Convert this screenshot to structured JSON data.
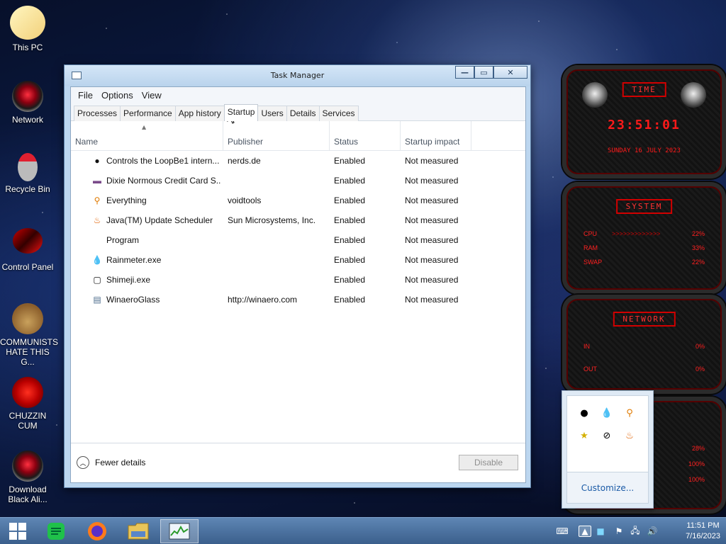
{
  "desktop": {
    "icons": [
      {
        "label": "This PC"
      },
      {
        "label": "Network"
      },
      {
        "label": "Recycle Bin"
      },
      {
        "label": "Control Panel"
      },
      {
        "label": "COMMUNISTS HATE THIS G..."
      },
      {
        "label": "CHUZZIN CUM"
      },
      {
        "label": "Download Black Ali..."
      }
    ]
  },
  "rainmeter": {
    "time": {
      "header": "TIME",
      "clock": "23:51:01",
      "date": "SUNDAY 16 JULY 2023"
    },
    "system": {
      "header": "SYSTEM",
      "rows": [
        {
          "label": "CPU",
          "value": "22%"
        },
        {
          "label": "RAM",
          "value": "33%"
        },
        {
          "label": "SWAP",
          "value": "22%"
        }
      ]
    },
    "network": {
      "header": "NETWORK",
      "rows": [
        {
          "label": "IN",
          "value": "0%"
        },
        {
          "label": "OUT",
          "value": "0%"
        }
      ]
    },
    "disk": {
      "rows": [
        {
          "value": "28%"
        },
        {
          "value": "100%"
        },
        {
          "value": "100%"
        }
      ]
    }
  },
  "tray_popup": {
    "customize": "Customize..."
  },
  "task_manager": {
    "title": "Task Manager",
    "menu": [
      "File",
      "Options",
      "View"
    ],
    "tabs": [
      "Processes",
      "Performance",
      "App history",
      "Startup",
      "Users",
      "Details",
      "Services"
    ],
    "active_tab": "Startup",
    "columns": [
      "Name",
      "Publisher",
      "Status",
      "Startup impact"
    ],
    "rows": [
      {
        "icon": "loopbe-icon",
        "name": "Controls the LoopBe1 intern...",
        "publisher": "nerds.de",
        "status": "Enabled",
        "impact": "Not measured"
      },
      {
        "icon": "card-icon",
        "name": "Dixie Normous Credit Card S...",
        "publisher": "",
        "status": "Enabled",
        "impact": "Not measured"
      },
      {
        "icon": "magnifier-icon",
        "name": "Everything",
        "publisher": "voidtools",
        "status": "Enabled",
        "impact": "Not measured"
      },
      {
        "icon": "java-icon",
        "name": "Java(TM) Update Scheduler",
        "publisher": "Sun Microsystems, Inc.",
        "status": "Enabled",
        "impact": "Not measured"
      },
      {
        "icon": "blank-icon",
        "name": "Program",
        "publisher": "",
        "status": "Enabled",
        "impact": "Not measured"
      },
      {
        "icon": "drop-icon",
        "name": "Rainmeter.exe",
        "publisher": "",
        "status": "Enabled",
        "impact": "Not measured"
      },
      {
        "icon": "shimeji-icon",
        "name": "Shimeji.exe",
        "publisher": "",
        "status": "Enabled",
        "impact": "Not measured"
      },
      {
        "icon": "window-icon",
        "name": "WinaeroGlass",
        "publisher": "http://winaero.com",
        "status": "Enabled",
        "impact": "Not measured"
      }
    ],
    "fewer_details": "Fewer details",
    "disable_button": "Disable"
  },
  "taskbar": {
    "time": "11:51 PM",
    "date": "7/16/2023"
  }
}
